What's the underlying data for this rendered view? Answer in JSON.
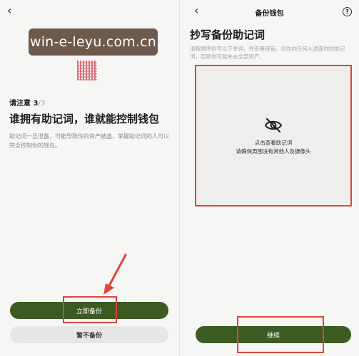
{
  "watermark": {
    "text": "win-e-leyu.com.cn"
  },
  "left": {
    "back_icon": "chevron-left-icon",
    "back_glyph": "‹",
    "note_label": "请注意 3",
    "note_total": "/3",
    "title": "谁拥有助记词，谁就能控制钱包",
    "description": "助记词一旦泄露，可能导致你的资产被盗，掌握助记词的人可以完全控制你的钱包。",
    "primary_button": "立即备份",
    "secondary_button": "暂不备份"
  },
  "right": {
    "back_icon": "chevron-left-icon",
    "back_glyph": "‹",
    "header_title": "备份钱包",
    "help_icon": "question-icon",
    "help_glyph": "?",
    "title": "抄写备份助记词",
    "description": "请按顺序抄写以下单词，并妥善保管。切勿向任何人透露你的助记词，否则你可能失去全部资产。",
    "box_line1": "点击查看助记词",
    "box_line2": "请确保周围没有其他人及摄像头",
    "eye_icon": "eye-slash-icon",
    "continue_button": "继续"
  },
  "colors": {
    "primary_button": "#3b5b23",
    "secondary_button": "#e6e6e4",
    "highlight": "#e0443a",
    "watermark_bg": "#6d5a4d"
  }
}
